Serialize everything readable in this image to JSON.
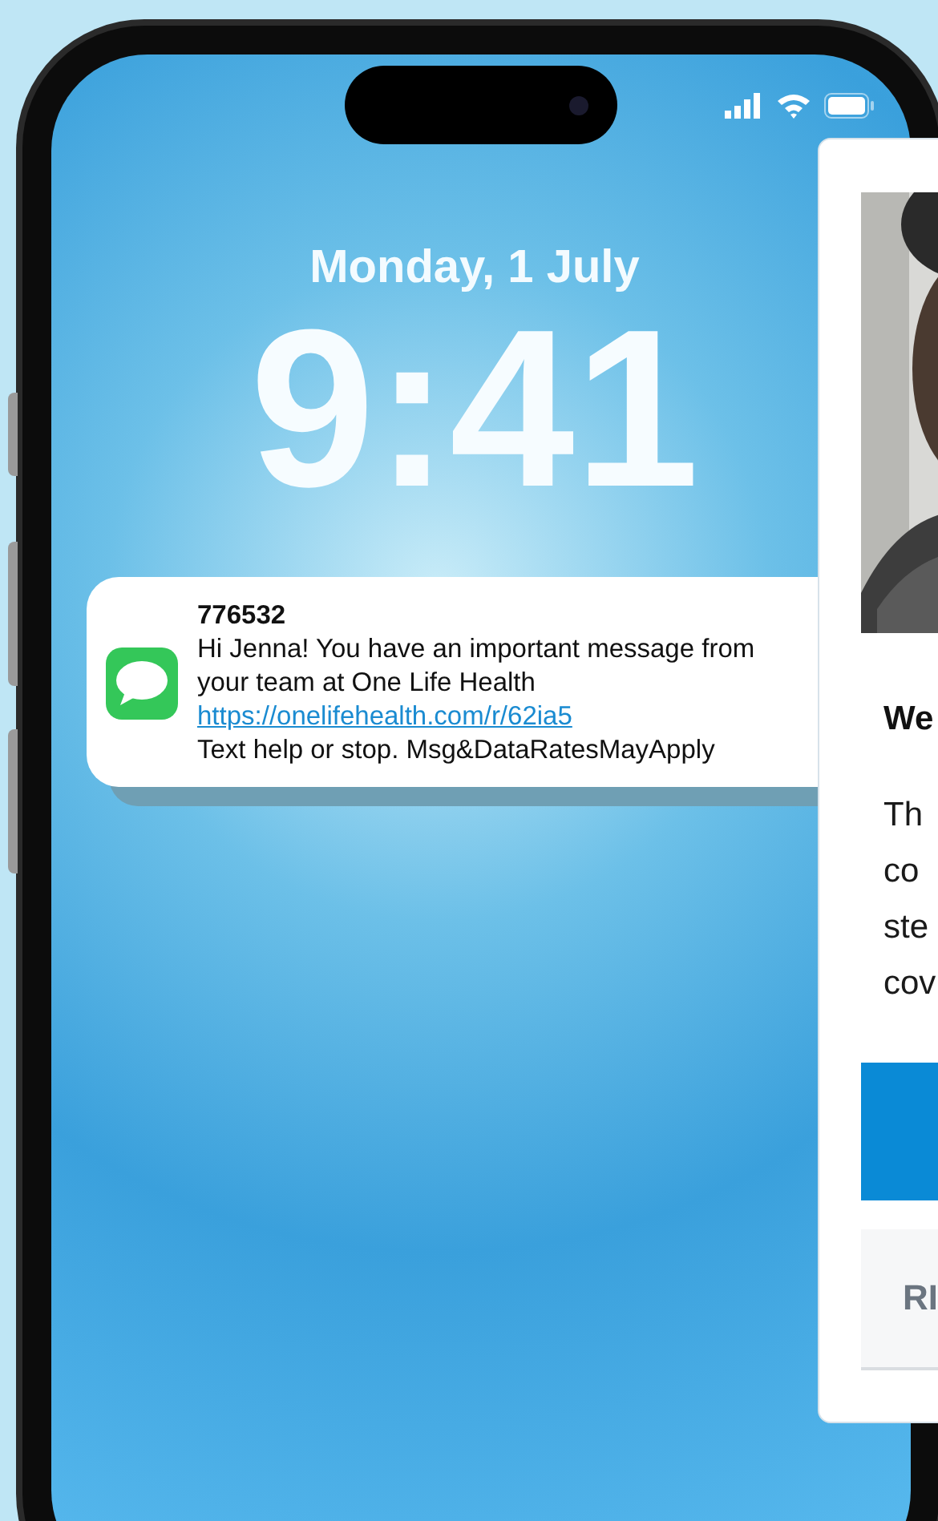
{
  "lock_screen": {
    "date": "Monday, 1 July",
    "time": "9:41"
  },
  "notification": {
    "sender": "776532",
    "message": "Hi Jenna! You have an important message from your team at One Life Health",
    "link": "https://onelifehealth.com/r/62ia5",
    "footer": "Text help or stop. Msg&DataRatesMayApply"
  },
  "card": {
    "heading": "We",
    "body_lines": [
      "Th",
      "co",
      "ste",
      "cov"
    ],
    "buttons": [
      {
        "kind": "primary"
      },
      {
        "kind": "secondary",
        "label": "RI"
      }
    ]
  }
}
